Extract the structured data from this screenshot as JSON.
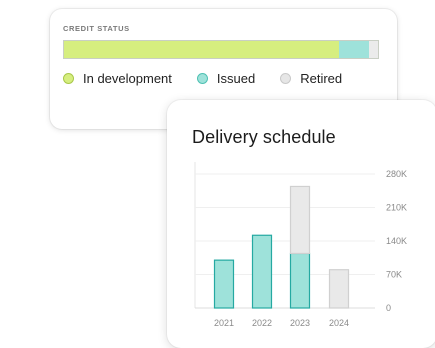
{
  "credit_status": {
    "title": "CREDIT STATUS",
    "bar": {
      "segments": [
        {
          "key": "in_development",
          "fraction": 0.875,
          "color": "#d6ee7f"
        },
        {
          "key": "issued",
          "fraction": 0.095,
          "color": "#9ee2da"
        },
        {
          "key": "retired",
          "fraction": 0.03,
          "color": "#ebebeb"
        }
      ]
    },
    "legend": [
      {
        "label": "In development",
        "color": "#d6ee7f",
        "border": "#a9c84a"
      },
      {
        "label": "Issued",
        "color": "#9ee2da",
        "border": "#4fc1b3"
      },
      {
        "label": "Retired",
        "color": "#e6e6e6",
        "border": "#c9c9c9"
      }
    ]
  },
  "delivery_schedule": {
    "title": "Delivery schedule"
  },
  "chart_data": {
    "type": "bar",
    "title": "Delivery schedule",
    "categories": [
      "2021",
      "2022",
      "2023",
      "2024"
    ],
    "series": [
      {
        "name": "Issued",
        "color": "#9ee2da",
        "stroke": "#25a9a2",
        "values": [
          100000,
          152000,
          114000,
          0
        ]
      },
      {
        "name": "Retired",
        "color": "#e9e9e9",
        "stroke": "#d0d0d0",
        "values": [
          0,
          0,
          140000,
          80000
        ]
      }
    ],
    "stacked": true,
    "y_ticks": [
      "0",
      "70K",
      "140K",
      "210K",
      "280K"
    ],
    "ylim": [
      0,
      280000
    ],
    "y_axis_position": "right",
    "grid": true
  }
}
